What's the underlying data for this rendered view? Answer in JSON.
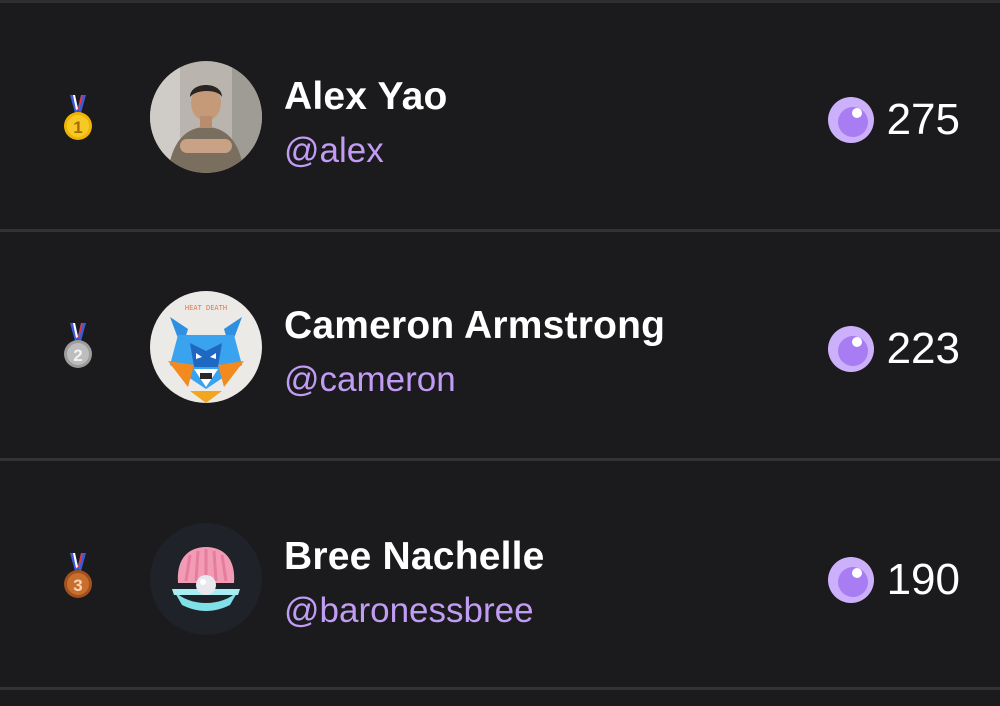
{
  "leaderboard": {
    "entries": [
      {
        "rank": "1",
        "name": "Alex Yao",
        "handle": "@alex",
        "score": "275",
        "medal_icon": "gold-medal-icon",
        "avatar": "photo-avatar"
      },
      {
        "rank": "2",
        "name": "Cameron Armstrong",
        "handle": "@cameron",
        "score": "223",
        "medal_icon": "silver-medal-icon",
        "avatar": "fox-avatar",
        "avatar_text": "HEAT DEATH"
      },
      {
        "rank": "3",
        "name": "Bree Nachelle",
        "handle": "@baronessbree",
        "score": "190",
        "medal_icon": "bronze-medal-icon",
        "avatar": "clam-pearl-avatar"
      }
    ]
  },
  "colors": {
    "background": "#1b1a1c",
    "handle": "#c19cf5",
    "coin": "#cdb0fb",
    "divider": "#333236"
  }
}
